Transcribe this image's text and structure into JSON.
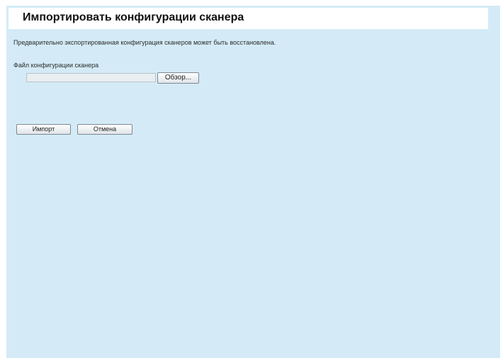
{
  "page": {
    "title": "Импортировать конфигурации сканера",
    "description": "Предварительно экспортированная конфигурация сканеров может быть восстановлена."
  },
  "file_section": {
    "label": "Файл конфигурации сканера",
    "input_value": "",
    "browse_label": "Обзор..."
  },
  "actions": {
    "import_label": "Импорт",
    "cancel_label": "Отмена"
  },
  "colors": {
    "background": "#d4ebf7",
    "title_bar": "#ffffff"
  }
}
